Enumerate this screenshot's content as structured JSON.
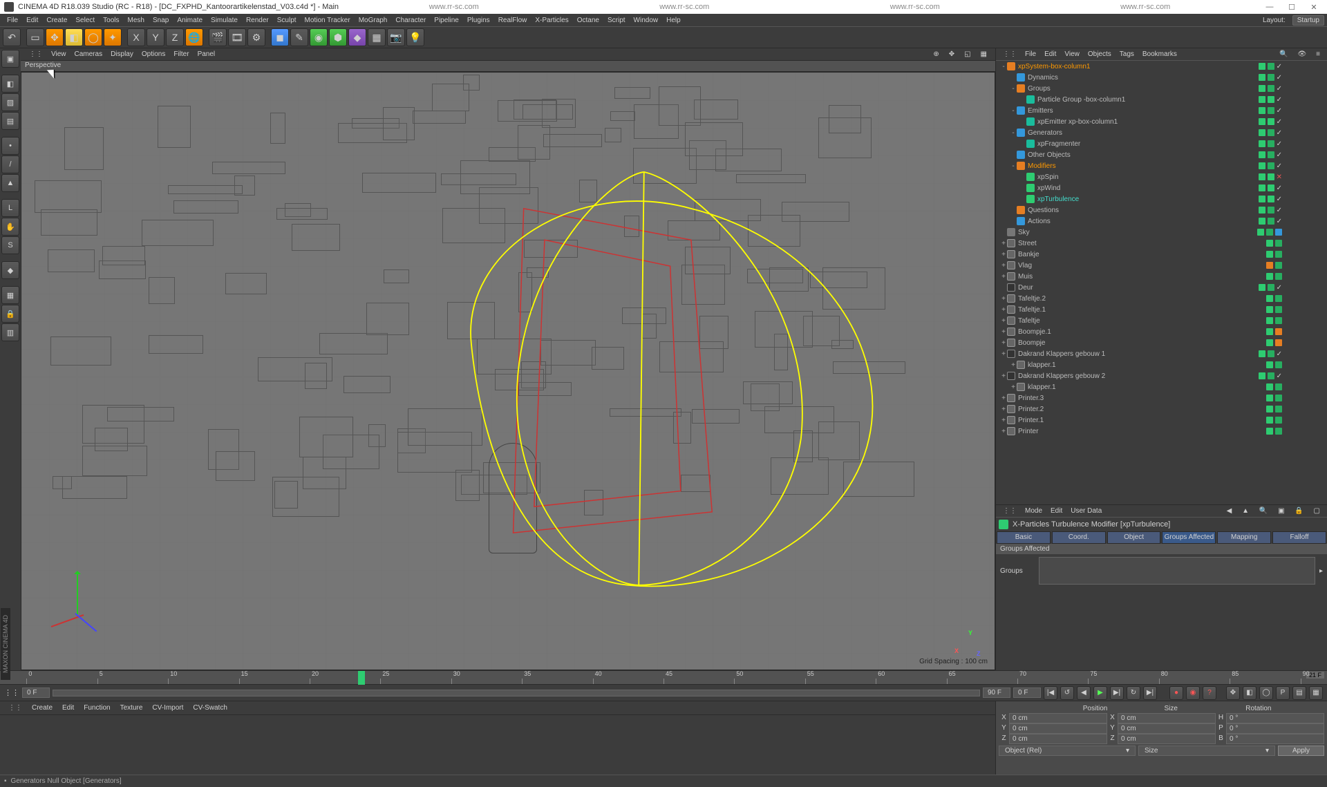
{
  "title": "CINEMA 4D R18.039 Studio (RC - R18) - [DC_FXPHD_Kantoorartikelenstad_V03.c4d *] - Main",
  "title_urls": [
    "www.rr-sc.com",
    "www.rr-sc.com",
    "www.rr-sc.com",
    "www.rr-sc.com"
  ],
  "menubar": [
    "File",
    "Edit",
    "Create",
    "Select",
    "Tools",
    "Mesh",
    "Snap",
    "Animate",
    "Simulate",
    "Render",
    "Sculpt",
    "Motion Tracker",
    "MoGraph",
    "Character",
    "Pipeline",
    "Plugins",
    "RealFlow",
    "X-Particles",
    "Octane",
    "Script",
    "Window",
    "Help"
  ],
  "layout": {
    "label": "Layout:",
    "value": "Startup"
  },
  "viewport": {
    "menus": [
      "View",
      "Cameras",
      "Display",
      "Options",
      "Filter",
      "Panel"
    ],
    "label": "Perspective",
    "grid_info": "Grid Spacing : 100 cm",
    "gizmo": {
      "x": "X",
      "y": "Y",
      "z": "Z"
    }
  },
  "objects_panel": {
    "menus": [
      "File",
      "Edit",
      "View",
      "Objects",
      "Tags",
      "Bookmarks"
    ]
  },
  "tree": [
    {
      "d": 0,
      "e": "-",
      "i": "ico-orange",
      "n": "xpSystem-box-column1",
      "hl": "hl-orange",
      "tags": [
        "g",
        "g2",
        "chk"
      ]
    },
    {
      "d": 1,
      "e": "",
      "i": "ico-blue",
      "n": "Dynamics",
      "tags": [
        "g",
        "g2",
        "chk"
      ]
    },
    {
      "d": 1,
      "e": "-",
      "i": "ico-orange",
      "n": "Groups",
      "tags": [
        "g",
        "g2",
        "chk"
      ]
    },
    {
      "d": 2,
      "e": "",
      "i": "ico-teal",
      "n": "Particle Group -box-column1",
      "tags": [
        "g",
        "g",
        "chk"
      ]
    },
    {
      "d": 1,
      "e": "-",
      "i": "ico-blue",
      "n": "Emitters",
      "tags": [
        "g",
        "g2",
        "chk"
      ]
    },
    {
      "d": 2,
      "e": "",
      "i": "ico-teal",
      "n": "xpEmitter xp-box-column1",
      "tags": [
        "g",
        "g",
        "chk"
      ]
    },
    {
      "d": 1,
      "e": "-",
      "i": "ico-blue",
      "n": "Generators",
      "tags": [
        "g",
        "g2",
        "chk"
      ]
    },
    {
      "d": 2,
      "e": "",
      "i": "ico-teal",
      "n": "xpFragmenter",
      "tags": [
        "g",
        "g2",
        "chk"
      ]
    },
    {
      "d": 1,
      "e": "",
      "i": "ico-blue",
      "n": "Other Objects",
      "tags": [
        "g",
        "g2",
        "chk"
      ]
    },
    {
      "d": 1,
      "e": "-",
      "i": "ico-orange",
      "n": "Modifiers",
      "hl": "hl-orange",
      "tags": [
        "g",
        "g2",
        "chk"
      ]
    },
    {
      "d": 2,
      "e": "",
      "i": "ico-green",
      "n": "xpSpin",
      "tags": [
        "g",
        "g",
        "x"
      ]
    },
    {
      "d": 2,
      "e": "",
      "i": "ico-green",
      "n": "xpWind",
      "tags": [
        "g",
        "g",
        "chk"
      ]
    },
    {
      "d": 2,
      "e": "",
      "i": "ico-green",
      "n": "xpTurbulence",
      "hl": "hl-teal",
      "tags": [
        "g",
        "g",
        "chk"
      ]
    },
    {
      "d": 1,
      "e": "",
      "i": "ico-orange",
      "n": "Questions",
      "tags": [
        "g",
        "g2",
        "chk"
      ]
    },
    {
      "d": 1,
      "e": "",
      "i": "ico-blue",
      "n": "Actions",
      "tags": [
        "g",
        "g2",
        "chk"
      ]
    },
    {
      "d": 0,
      "e": "",
      "i": "ico-grey",
      "n": "Sky",
      "tags": [
        "g",
        "g2",
        "b"
      ]
    },
    {
      "d": 0,
      "e": "+",
      "i": "ico-layer",
      "n": "Street",
      "tags": [
        "g",
        "g2"
      ]
    },
    {
      "d": 0,
      "e": "+",
      "i": "ico-layer",
      "n": "Bankje",
      "tags": [
        "g",
        "g2"
      ]
    },
    {
      "d": 0,
      "e": "+",
      "i": "ico-layer",
      "n": "Vlag",
      "tags": [
        "o",
        "g2"
      ]
    },
    {
      "d": 0,
      "e": "+",
      "i": "ico-layer",
      "n": "Muis",
      "tags": [
        "g",
        "g2"
      ]
    },
    {
      "d": 0,
      "e": "",
      "i": "ico-null",
      "n": "Deur",
      "tags": [
        "g",
        "g2",
        "chk"
      ]
    },
    {
      "d": 0,
      "e": "+",
      "i": "ico-layer",
      "n": "Tafeltje.2",
      "tags": [
        "g",
        "g2"
      ]
    },
    {
      "d": 0,
      "e": "+",
      "i": "ico-layer",
      "n": "Tafeltje.1",
      "tags": [
        "g",
        "g2"
      ]
    },
    {
      "d": 0,
      "e": "+",
      "i": "ico-layer",
      "n": "Tafeltje",
      "tags": [
        "g",
        "g2"
      ]
    },
    {
      "d": 0,
      "e": "+",
      "i": "ico-layer",
      "n": "Boompje.1",
      "tags": [
        "g",
        "o"
      ]
    },
    {
      "d": 0,
      "e": "+",
      "i": "ico-layer",
      "n": "Boompje",
      "tags": [
        "g",
        "o"
      ]
    },
    {
      "d": 0,
      "e": "+",
      "i": "ico-null",
      "n": "Dakrand Klappers gebouw 1",
      "tags": [
        "g",
        "g2",
        "chk"
      ]
    },
    {
      "d": 1,
      "e": "+",
      "i": "ico-layer",
      "n": "klapper.1",
      "tags": [
        "g",
        "g2"
      ]
    },
    {
      "d": 0,
      "e": "+",
      "i": "ico-null",
      "n": "Dakrand Klappers gebouw 2",
      "tags": [
        "g",
        "g2",
        "chk"
      ]
    },
    {
      "d": 1,
      "e": "+",
      "i": "ico-layer",
      "n": "klapper.1",
      "tags": [
        "g",
        "g2"
      ]
    },
    {
      "d": 0,
      "e": "+",
      "i": "ico-layer",
      "n": "Printer.3",
      "tags": [
        "g",
        "g2"
      ]
    },
    {
      "d": 0,
      "e": "+",
      "i": "ico-layer",
      "n": "Printer.2",
      "tags": [
        "g",
        "g2"
      ]
    },
    {
      "d": 0,
      "e": "+",
      "i": "ico-layer",
      "n": "Printer.1",
      "tags": [
        "g",
        "g2"
      ]
    },
    {
      "d": 0,
      "e": "+",
      "i": "ico-layer",
      "n": "Printer",
      "tags": [
        "g",
        "g2"
      ]
    }
  ],
  "attribute": {
    "menus": [
      "Mode",
      "Edit",
      "User Data"
    ],
    "title": "X-Particles Turbulence Modifier [xpTurbulence]",
    "tabs": [
      "Basic",
      "Coord.",
      "Object",
      "Groups Affected",
      "Mapping",
      "Falloff"
    ],
    "active_tab": 3,
    "section": "Groups Affected",
    "field_label": "Groups"
  },
  "timeline": {
    "start_frame": "0 F",
    "slider_end": "90 F",
    "current_frame": "0 F",
    "end_label": "21 F",
    "ticks": [
      0,
      5,
      10,
      15,
      20,
      25,
      30,
      35,
      40,
      45,
      50,
      55,
      60,
      65,
      70,
      75,
      80,
      85,
      90
    ],
    "playhead_pos_pct": 27
  },
  "material_shelf": [
    "Create",
    "Edit",
    "Function",
    "Texture",
    "CV-Import",
    "CV-Swatch"
  ],
  "coord": {
    "headers": [
      "Position",
      "Size",
      "Rotation"
    ],
    "rows": [
      {
        "axis": "X",
        "p": "0 cm",
        "s": "0 cm",
        "rlbl": "H",
        "r": "0 °"
      },
      {
        "axis": "Y",
        "p": "0 cm",
        "s": "0 cm",
        "rlbl": "P",
        "r": "0 °"
      },
      {
        "axis": "Z",
        "p": "0 cm",
        "s": "0 cm",
        "rlbl": "B",
        "r": "0 °"
      }
    ],
    "dd1": "Object (Rel)",
    "dd2": "Size",
    "apply": "Apply"
  },
  "status": "Generators Null Object [Generators]",
  "sidebar_label": "MAXON CINEMA 4D"
}
